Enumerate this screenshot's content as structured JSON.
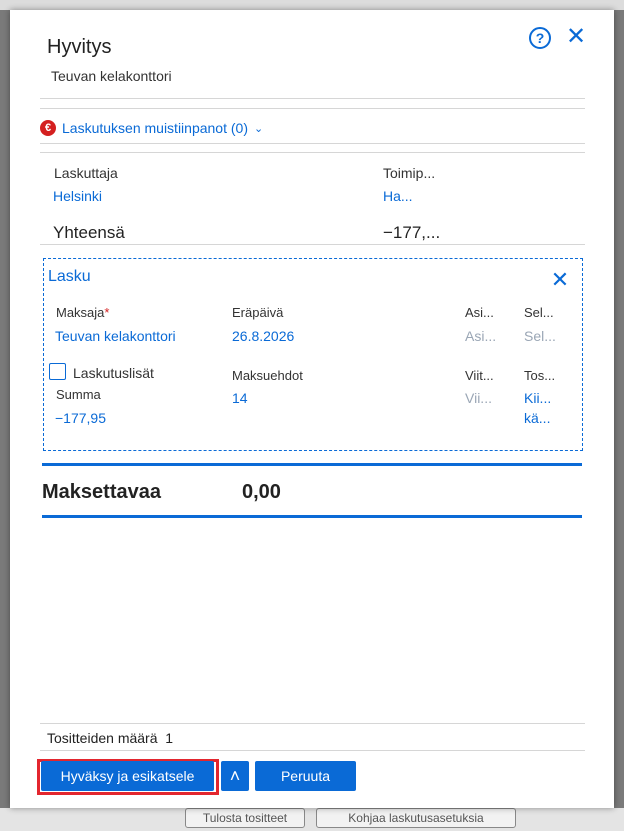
{
  "background": {
    "left_button": "Tulosta tositteet",
    "right_button": "Kohjaa laskutusasetuksia"
  },
  "dialog": {
    "title": "Hyvitys",
    "subtitle": "Teuvan kelakonttori",
    "help_icon": "?",
    "close_icon": "✕"
  },
  "notes": {
    "icon": "euro-icon",
    "icon_glyph": "€",
    "label": "Laskutuksen muistiinpanot (0)",
    "chevron": "⌄"
  },
  "summary": {
    "laskuttaja_label": "Laskuttaja",
    "laskuttaja_value": "Helsinki",
    "toimipiste_label": "Toimip...",
    "toimipiste_value": "Ha...",
    "yhteensa_label": "Yhteensä",
    "yhteensa_value": "−177,..."
  },
  "lasku": {
    "title": "Lasku",
    "close": "✕",
    "maksaja_label": "Maksaja",
    "required_mark": "*",
    "maksaja_value": "Teuvan kelakonttori",
    "erapaiva_label": "Eräpäivä",
    "erapaiva_value": "26.8.2026",
    "asi_label": "Asi...",
    "asi_placeholder": "Asi...",
    "sel_label": "Sel...",
    "sel_placeholder": "Sel...",
    "laskutuslisat_label": "Laskutuslisät",
    "summa_label": "Summa",
    "summa_value": "−177,95",
    "maksuehdot_label": "Maksuehdot",
    "maksuehdot_value": "14",
    "viit_label": "Viit...",
    "viit_placeholder": "Vii...",
    "tos_label": "Tos...",
    "tos_value_1": "Kii...",
    "tos_value_2": "kä..."
  },
  "maksettavaa": {
    "label": "Maksettavaa",
    "value": "0,00"
  },
  "footer": {
    "count_label": "Tositteiden määrä",
    "count_value": "1",
    "approve_button": "Hyväksy ja esikatsele",
    "expand_icon": "˄",
    "cancel_button": "Peruuta"
  },
  "colors": {
    "accent": "#0a6ad6",
    "focus": "#e3262e",
    "euro_badge": "#d42020"
  }
}
